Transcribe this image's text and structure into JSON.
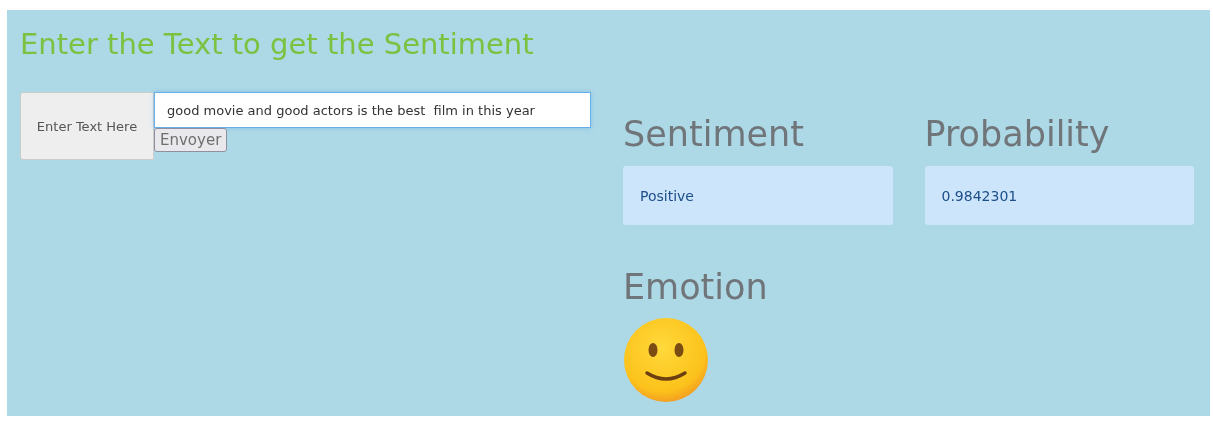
{
  "title": "Enter the Text to get the Sentiment",
  "form": {
    "label": "Enter Text Here",
    "value": "good movie and good actors is the best  film in this year",
    "button": "Envoyer"
  },
  "results": [
    {
      "heading": "Sentiment",
      "value": "Positive"
    },
    {
      "heading": "Probability",
      "value": "0.9842301"
    }
  ],
  "emotion": {
    "heading": "Emotion",
    "kind": "positive"
  }
}
